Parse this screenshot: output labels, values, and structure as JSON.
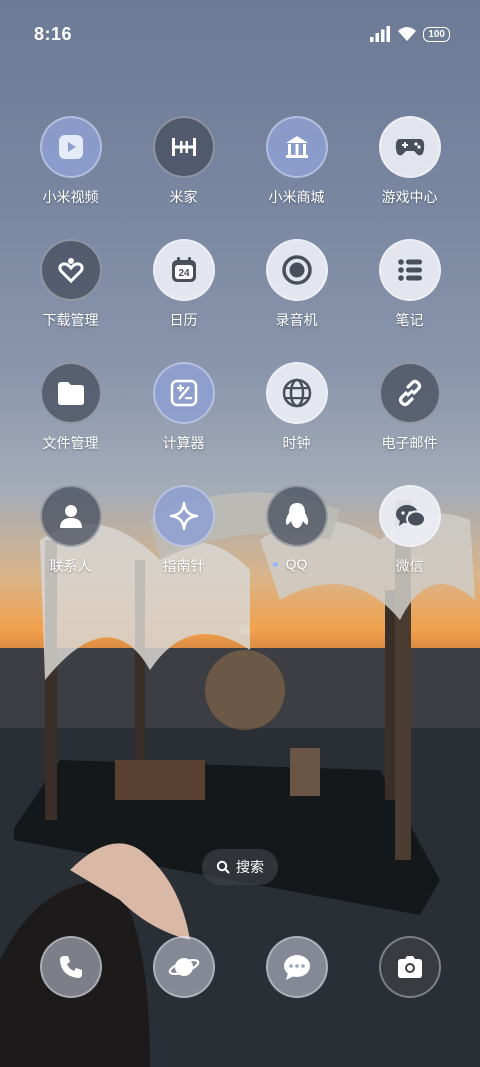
{
  "status_bar": {
    "time": "8:16",
    "battery": "100"
  },
  "apps": [
    {
      "label": "小米视频",
      "icon": "play-icon"
    },
    {
      "label": "米家",
      "icon": "mijia-icon"
    },
    {
      "label": "小米商城",
      "icon": "store-icon"
    },
    {
      "label": "游戏中心",
      "icon": "gamepad-icon"
    },
    {
      "label": "下载管理",
      "icon": "download-heart-icon"
    },
    {
      "label": "日历",
      "icon": "calendar-icon",
      "day": "24"
    },
    {
      "label": "录音机",
      "icon": "record-icon"
    },
    {
      "label": "笔记",
      "icon": "notes-list-icon"
    },
    {
      "label": "文件管理",
      "icon": "folder-icon"
    },
    {
      "label": "计算器",
      "icon": "calculator-icon"
    },
    {
      "label": "时钟",
      "icon": "globe-clock-icon"
    },
    {
      "label": "电子邮件",
      "icon": "link-icon"
    },
    {
      "label": "联系人",
      "icon": "contact-icon"
    },
    {
      "label": "指南针",
      "icon": "compass-sparkle-icon"
    },
    {
      "label": "QQ",
      "icon": "qq-penguin-icon"
    },
    {
      "label": "微信",
      "icon": "wechat-icon"
    }
  ],
  "search": {
    "label": "搜索"
  },
  "dock": [
    {
      "icon": "phone-icon"
    },
    {
      "icon": "browser-planet-icon"
    },
    {
      "icon": "messages-icon"
    },
    {
      "icon": "camera-icon"
    }
  ]
}
